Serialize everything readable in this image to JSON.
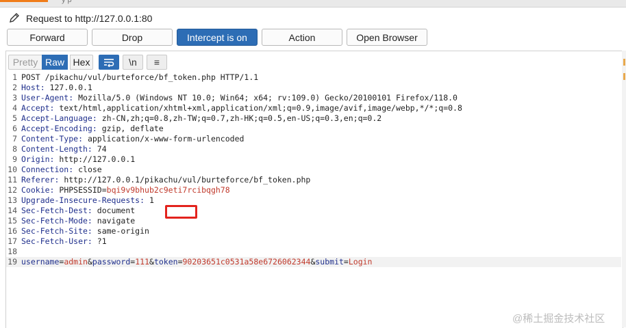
{
  "top_tab": {
    "text": "y  p"
  },
  "request": {
    "title": "Request to http://127.0.0.1:80"
  },
  "buttons": {
    "forward": "Forward",
    "drop": "Drop",
    "intercept": "Intercept is on",
    "action": "Action",
    "open_browser": "Open Browser"
  },
  "view_modes": {
    "pretty": "Pretty",
    "raw": "Raw",
    "hex": "Hex"
  },
  "tools": {
    "newline": "\\n",
    "menu": "≡"
  },
  "code_lines": [
    {
      "n": "1",
      "text": "POST /pikachu/vul/burteforce/bf_token.php HTTP/1.1"
    },
    {
      "n": "2",
      "key": "Host:",
      "value": " 127.0.0.1"
    },
    {
      "n": "3",
      "key": "User-Agent:",
      "value": " Mozilla/5.0 (Windows NT 10.0; Win64; x64; rv:109.0) Gecko/20100101 Firefox/118.0"
    },
    {
      "n": "4",
      "key": "Accept:",
      "value": " text/html,application/xhtml+xml,application/xml;q=0.9,image/avif,image/webp,*/*;q=0.8"
    },
    {
      "n": "5",
      "key": "Accept-Language:",
      "value": " zh-CN,zh;q=0.8,zh-TW;q=0.7,zh-HK;q=0.5,en-US;q=0.3,en;q=0.2"
    },
    {
      "n": "6",
      "key": "Accept-Encoding:",
      "value": " gzip, deflate"
    },
    {
      "n": "7",
      "key": "Content-Type:",
      "value": " application/x-www-form-urlencoded"
    },
    {
      "n": "8",
      "key": "Content-Length:",
      "value": " 74"
    },
    {
      "n": "9",
      "key": "Origin:",
      "value": " http://127.0.0.1"
    },
    {
      "n": "10",
      "key": "Connection:",
      "value": " close"
    },
    {
      "n": "11",
      "key": "Referer:",
      "value": " http://127.0.0.1/pikachu/vul/burteforce/bf_token.php"
    },
    {
      "n": "12",
      "key": "Cookie:",
      "value": " PHPSESSID=",
      "value2": "bqi9v9bhub2c9eti7rcibqgh78"
    },
    {
      "n": "13",
      "key": "Upgrade-Insecure-Requests:",
      "value": " 1"
    },
    {
      "n": "14",
      "key": "Sec-Fetch-Dest:",
      "value": " document"
    },
    {
      "n": "15",
      "key": "Sec-Fetch-Mode:",
      "value": " navigate"
    },
    {
      "n": "16",
      "key": "Sec-Fetch-Site:",
      "value": " same-origin"
    },
    {
      "n": "17",
      "key": "Sec-Fetch-User:",
      "value": " ?1"
    },
    {
      "n": "18",
      "text": ""
    },
    {
      "n": "19",
      "params": [
        {
          "k": "username",
          "v": "admin"
        },
        {
          "k": "password",
          "v": "111"
        },
        {
          "k": "token",
          "v": "90203651c0531a58e6726062344"
        },
        {
          "k": "submit",
          "v": "Login"
        }
      ]
    }
  ],
  "watermark": "@稀土掘金技术社区",
  "colors": {
    "accent": "#2d6db5",
    "highlight": "#e3231d",
    "param_value": "#c0392b",
    "header_key": "#1f2f8c"
  }
}
